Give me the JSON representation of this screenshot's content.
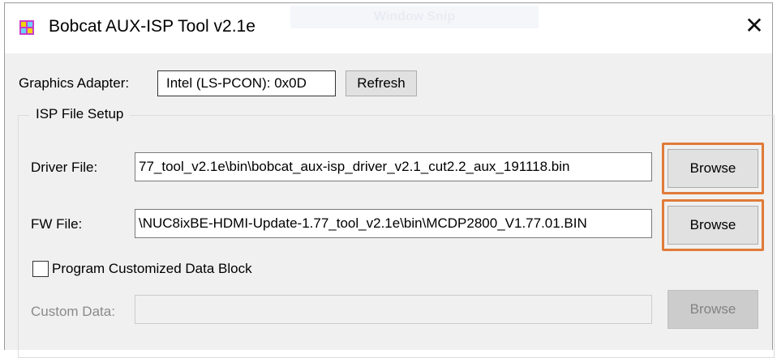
{
  "window": {
    "title": "Bobcat AUX-ISP Tool v2.1e",
    "ghost_label": "Window Snip",
    "close_glyph": "✕"
  },
  "adapter": {
    "label": "Graphics Adapter:",
    "value": "Intel (LS-PCON): 0x0D",
    "refresh_label": "Refresh"
  },
  "isp_setup": {
    "group_title": "ISP File Setup",
    "driver_label": "Driver File:",
    "driver_path": "77_tool_v2.1e\\bin\\bobcat_aux-isp_driver_v2.1_cut2.2_aux_191118.bin",
    "driver_browse": "Browse",
    "fw_label": "FW File:",
    "fw_path": "\\NUC8ixBE-HDMI-Update-1.77_tool_v2.1e\\bin\\MCDP2800_V1.77.01.BIN",
    "fw_browse": "Browse",
    "custom_checkbox_label": "Program Customized Data Block",
    "custom_checked": false,
    "custom_label": "Custom Data:",
    "custom_value": "",
    "custom_browse": "Browse"
  },
  "colors": {
    "highlight": "#e07b39",
    "window_bg": "#f0f0f0",
    "button_bg": "#e1e1e1"
  }
}
